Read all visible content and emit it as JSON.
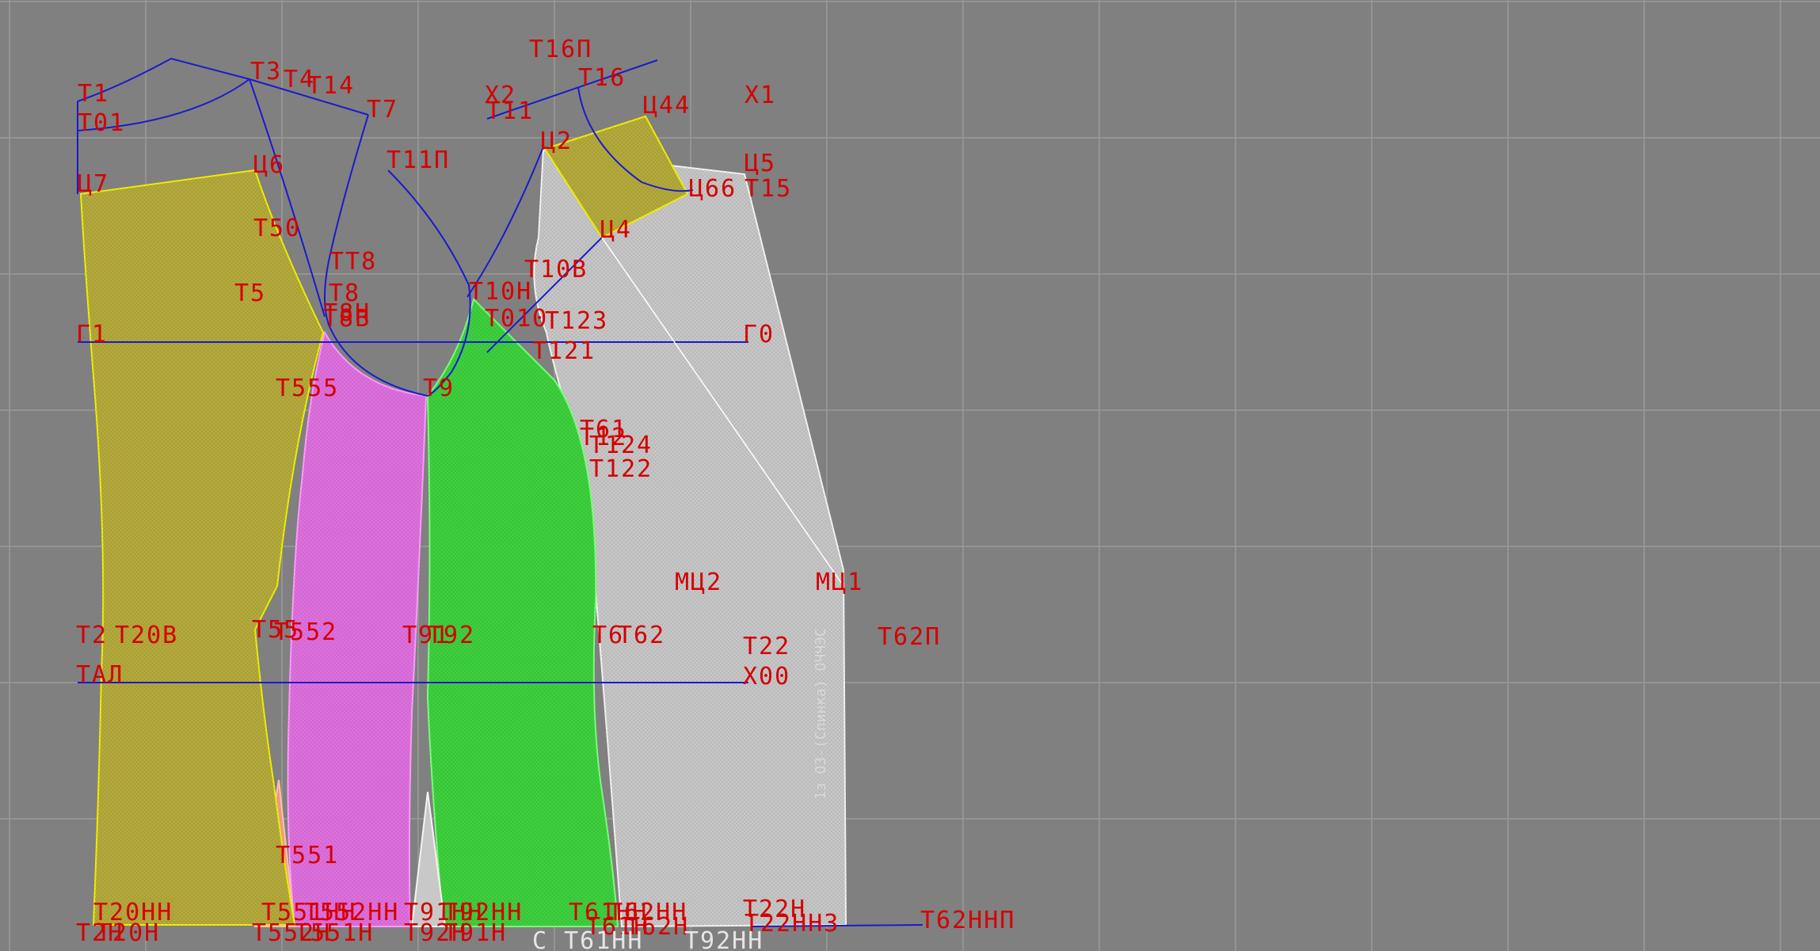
{
  "colors": {
    "background": "#808080",
    "grid": "#9a9a9a",
    "construction_line": "#1a1acc",
    "label": "#d40000",
    "yellow_piece": "#b5ab3c",
    "magenta_piece": "#e070e0",
    "green_piece": "#3ed23e",
    "white_piece": "#c8c8c8",
    "salmon_piece": "#e89a8a"
  },
  "pieces": [
    {
      "name": "yellow-back-panel",
      "color": "#b5ab3c",
      "stroke": "#f0f000"
    },
    {
      "name": "yellow-shoulder-yoke",
      "color": "#b5ab3c",
      "stroke": "#f0f000"
    },
    {
      "name": "magenta-side-panel",
      "color": "#e070e0",
      "stroke": "#ff9cff"
    },
    {
      "name": "green-side-panel",
      "color": "#3ed23e",
      "stroke": "#7cff7c"
    },
    {
      "name": "white-front-panel",
      "color": "#c8c8c8",
      "stroke": "#f4f4f4"
    }
  ],
  "labels": [
    {
      "id": "lbl-t1",
      "text": "Т1"
    },
    {
      "id": "lbl-t01",
      "text": "Т01"
    },
    {
      "id": "lbl-t3",
      "text": "Т3"
    },
    {
      "id": "lbl-t4",
      "text": "Т4"
    },
    {
      "id": "lbl-t14",
      "text": "Т14"
    },
    {
      "id": "lbl-t7",
      "text": "Т7"
    },
    {
      "id": "lbl-ts7",
      "text": "Ц7"
    },
    {
      "id": "lbl-ts6",
      "text": "Ц6"
    },
    {
      "id": "lbl-t50",
      "text": "Т50"
    },
    {
      "id": "lbl-tt8",
      "text": "ТТ8"
    },
    {
      "id": "lbl-t5",
      "text": "Т5"
    },
    {
      "id": "lbl-t8",
      "text": "Т8"
    },
    {
      "id": "lbl-t8n",
      "text": "Т8Н"
    },
    {
      "id": "lbl-t8v",
      "text": "Т8В"
    },
    {
      "id": "lbl-g1",
      "text": "Г1"
    },
    {
      "id": "lbl-t11p",
      "text": "Т11П"
    },
    {
      "id": "lbl-t16p",
      "text": "Т16П"
    },
    {
      "id": "lbl-kh2",
      "text": "Х2"
    },
    {
      "id": "lbl-t11",
      "text": "Т11"
    },
    {
      "id": "lbl-t16",
      "text": "Т16"
    },
    {
      "id": "lbl-ts44",
      "text": "Ц44"
    },
    {
      "id": "lbl-kh1",
      "text": "Х1"
    },
    {
      "id": "lbl-ts2",
      "text": "Ц2"
    },
    {
      "id": "lbl-ts5",
      "text": "Ц5"
    },
    {
      "id": "lbl-ts66",
      "text": "Ц66"
    },
    {
      "id": "lbl-t15",
      "text": "Т15"
    },
    {
      "id": "lbl-ts4",
      "text": "Ц4"
    },
    {
      "id": "lbl-t10v",
      "text": "Т10В"
    },
    {
      "id": "lbl-t10n",
      "text": "Т10Н"
    },
    {
      "id": "lbl-t010",
      "text": "Т010"
    },
    {
      "id": "lbl-t123",
      "text": "Т123"
    },
    {
      "id": "lbl-g0",
      "text": "Г0"
    },
    {
      "id": "lbl-t121",
      "text": "Т121"
    },
    {
      "id": "lbl-t555",
      "text": "Т555"
    },
    {
      "id": "lbl-t9",
      "text": "Т9"
    },
    {
      "id": "lbl-t61",
      "text": "Т61"
    },
    {
      "id": "lbl-t12",
      "text": "Т12"
    },
    {
      "id": "lbl-t124",
      "text": "Т124"
    },
    {
      "id": "lbl-t122",
      "text": "Т122"
    },
    {
      "id": "lbl-mts2",
      "text": "МЦ2"
    },
    {
      "id": "lbl-mts1",
      "text": "МЦ1"
    },
    {
      "id": "lbl-t2",
      "text": "Т2"
    },
    {
      "id": "lbl-t20v",
      "text": "Т20В"
    },
    {
      "id": "lbl-t55",
      "text": "Т55"
    },
    {
      "id": "lbl-t552",
      "text": "Т552"
    },
    {
      "id": "lbl-t91",
      "text": "Т91"
    },
    {
      "id": "lbl-t92",
      "text": "Т92"
    },
    {
      "id": "lbl-t6",
      "text": "Т6"
    },
    {
      "id": "lbl-t62",
      "text": "Т62"
    },
    {
      "id": "lbl-t22",
      "text": "Т22"
    },
    {
      "id": "lbl-t62p",
      "text": "Т62П"
    },
    {
      "id": "lbl-tal",
      "text": "ТАЛ"
    },
    {
      "id": "lbl-kh00",
      "text": "Х00"
    },
    {
      "id": "lbl-t551",
      "text": "Т551"
    },
    {
      "id": "lbl-t20nn",
      "text": "Т20НН"
    },
    {
      "id": "lbl-t551nn",
      "text": "Т551НН"
    },
    {
      "id": "lbl-t552nn",
      "text": "Т552НН"
    },
    {
      "id": "lbl-t91nn",
      "text": "Т91НН"
    },
    {
      "id": "lbl-t92nn",
      "text": "Т92НН"
    },
    {
      "id": "lbl-t61nn",
      "text": "Т61НН"
    },
    {
      "id": "lbl-t62nn",
      "text": "Т62НН"
    },
    {
      "id": "lbl-t22n",
      "text": "Т22Н"
    },
    {
      "id": "lbl-t22nn3",
      "text": "Т22НН3"
    },
    {
      "id": "lbl-t62nnp",
      "text": "Т62ННП"
    },
    {
      "id": "lbl-t2n",
      "text": "Т2Н"
    },
    {
      "id": "lbl-t20n",
      "text": "Т20Н"
    },
    {
      "id": "lbl-t552n",
      "text": "Т552Н"
    },
    {
      "id": "lbl-t551n",
      "text": "Т551Н"
    },
    {
      "id": "lbl-t92n",
      "text": "Т92Н"
    },
    {
      "id": "lbl-t91n",
      "text": "Т91Н"
    },
    {
      "id": "lbl-t61n",
      "text": "Т61Н"
    },
    {
      "id": "lbl-t62n",
      "text": "Т62Н"
    },
    {
      "id": "lbl-s-t61hh",
      "text": "С  Т61НН"
    },
    {
      "id": "lbl-t92hh",
      "text": "Т92НН"
    },
    {
      "id": "lbl-vertical-note",
      "text": "1з  ОЗ-(Спинка)  ОЧЧЭС"
    }
  ]
}
